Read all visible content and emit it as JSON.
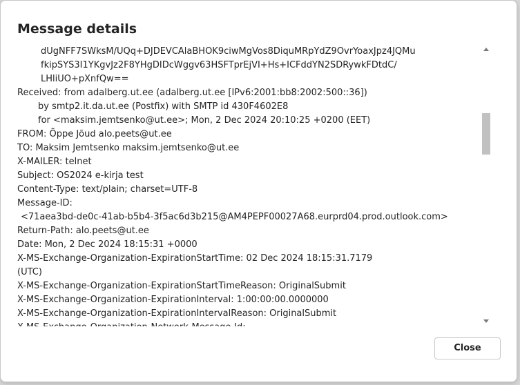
{
  "dialog": {
    "title": "Message details",
    "close_label": "Close"
  },
  "headers": [
    {
      "text": "dUgNFF7SWksM/UQq+DJDEVCAlaBHOK9ciwMgVos8DiquMRpYdZ9OvrYoaxJpz4JQMu",
      "indent": 1
    },
    {
      "text": "fkipSYS3I1YKgvJz2F8YHgDIDcWggv63HSFTprEjVI+Hs+ICFddYN2SDRywkFDtdC/",
      "indent": 1
    },
    {
      "text": "LHliUO+pXnfQw==",
      "indent": 1
    },
    {
      "text": "Received: from adalberg.ut.ee (adalberg.ut.ee [IPv6:2001:bb8:2002:500::36])",
      "indent": 0
    },
    {
      "text": "by smtp2.it.da.ut.ee (Postfix) with SMTP id 430F4602E8",
      "indent": 2
    },
    {
      "text": "for <maksim.jemtsenko@ut.ee>; Mon,  2 Dec 2024 20:10:25 +0200 (EET)",
      "indent": 2
    },
    {
      "text": "FROM: Õppe Jõud alo.peets@ut.ee",
      "indent": 0
    },
    {
      "text": "TO: Maksim Jemtsenko maksim.jemtsenko@ut.ee",
      "indent": 0
    },
    {
      "text": "X-MAILER: telnet",
      "indent": 0
    },
    {
      "text": "Subject: OS2024 e-kirja test",
      "indent": 0
    },
    {
      "text": "Content-Type: text/plain; charset=UTF-8",
      "indent": 0
    },
    {
      "text": "Message-ID:",
      "indent": 0
    },
    {
      "text": "<71aea3bd-de0c-41ab-b5b4-3f5ac6d3b215@AM4PEPF00027A68.eurprd04.prod.outlook.com>",
      "indent": 3
    },
    {
      "text": "Return-Path: alo.peets@ut.ee",
      "indent": 0
    },
    {
      "text": "Date: Mon, 2 Dec 2024 18:15:31 +0000",
      "indent": 0
    },
    {
      "text": "X-MS-Exchange-Organization-ExpirationStartTime: 02 Dec 2024 18:15:31.7179",
      "indent": 0
    },
    {
      "text": "(UTC)",
      "indent": 0
    },
    {
      "text": "X-MS-Exchange-Organization-ExpirationStartTimeReason: OriginalSubmit",
      "indent": 0
    },
    {
      "text": "X-MS-Exchange-Organization-ExpirationInterval: 1:00:00:00.0000000",
      "indent": 0
    },
    {
      "text": "X-MS-Exchange-Organization-ExpirationIntervalReason: OriginalSubmit",
      "indent": 0
    },
    {
      "text": "X-MS-Exchange-Organization-Network-Message-Id:",
      "indent": 0
    }
  ]
}
